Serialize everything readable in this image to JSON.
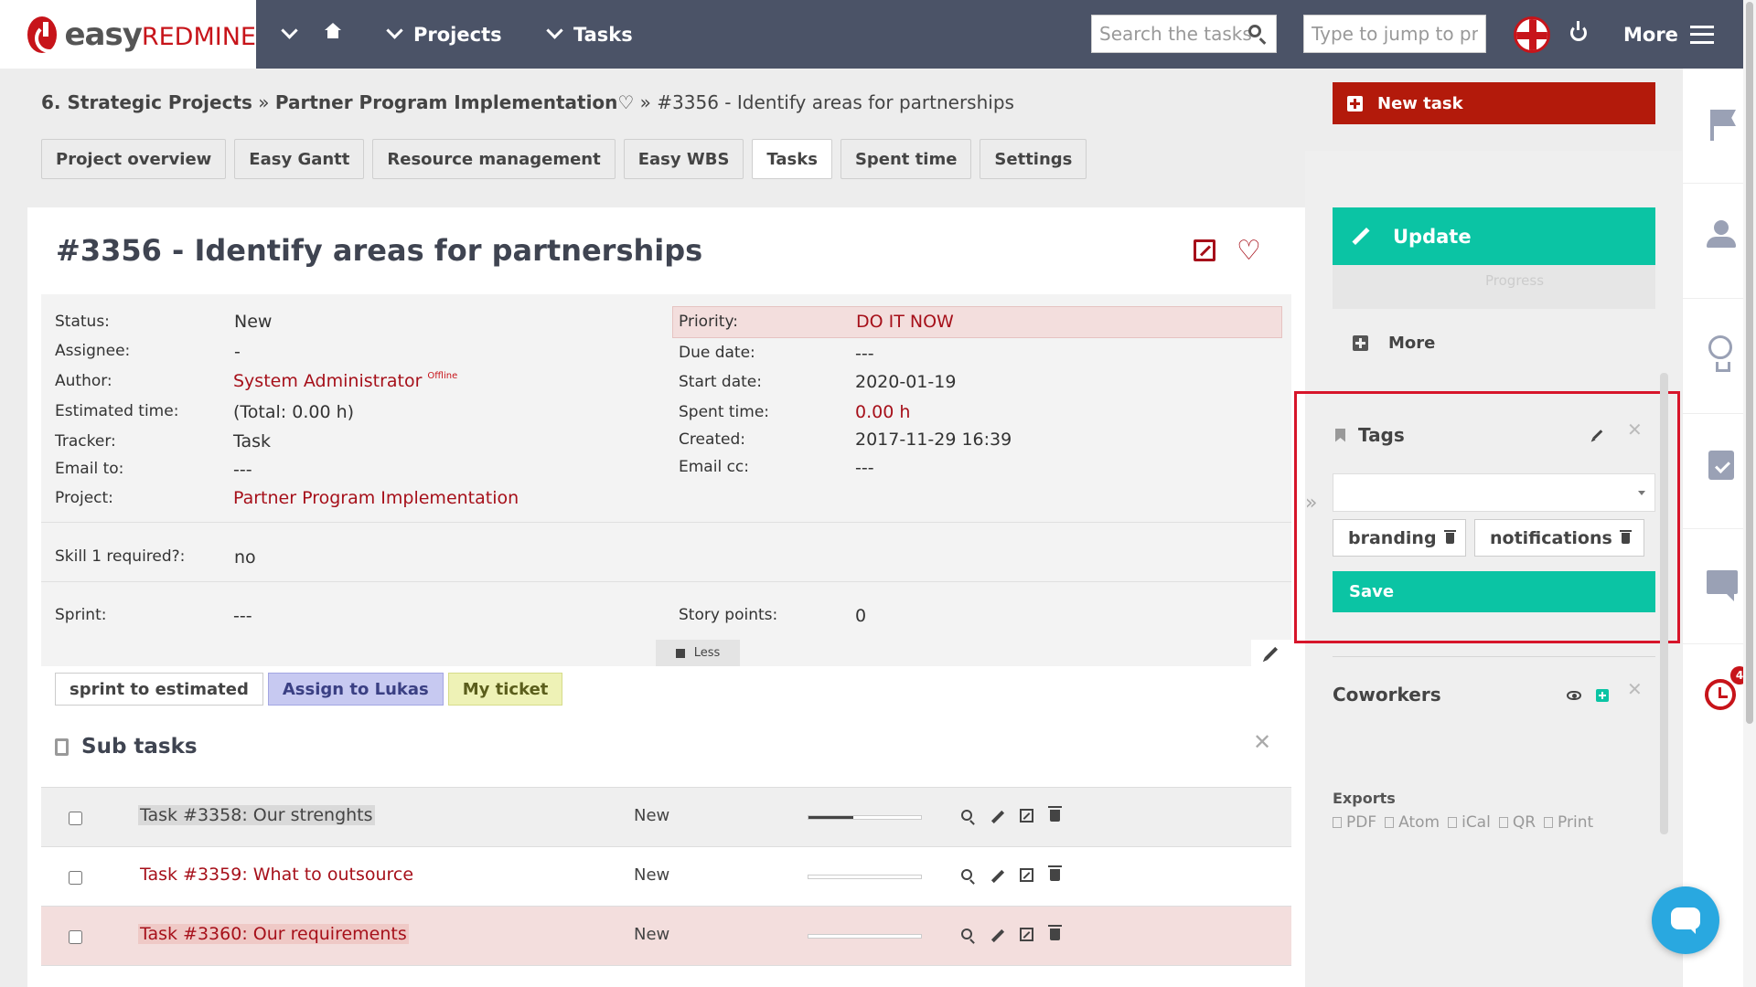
{
  "app": {
    "logo_main": "easy",
    "logo_sub": "REDMINE"
  },
  "topnav": {
    "projects_label": "Projects",
    "tasks_label": "Tasks",
    "search_placeholder": "Search the tasks",
    "jump_placeholder": "Type to jump to project",
    "more_label": "More"
  },
  "breadcrumb": {
    "parent": "6. Strategic Projects",
    "sep1": " » ",
    "project": "Partner Program Implementation♡",
    "sep2": " » ",
    "current": "#3356 - Identify areas for partnerships"
  },
  "project_tabs": [
    {
      "label": "Project overview",
      "active": false
    },
    {
      "label": "Easy Gantt",
      "active": false
    },
    {
      "label": "Resource management",
      "active": false
    },
    {
      "label": "Easy WBS",
      "active": false
    },
    {
      "label": "Tasks",
      "active": true
    },
    {
      "label": "Spent time",
      "active": false
    },
    {
      "label": "Settings",
      "active": false
    }
  ],
  "issue": {
    "title": "#3356 - Identify areas for partnerships",
    "favorite_icon": "♡",
    "left_attrs": {
      "status_label": "Status:",
      "status": "New",
      "assignee_label": "Assignee:",
      "assignee": "-",
      "author_label": "Author:",
      "author": "System Administrator",
      "author_state": "Offline",
      "estimated_label": "Estimated time:",
      "estimated": "(Total: 0.00 h)",
      "tracker_label": "Tracker:",
      "tracker": "Task",
      "email_to_label": "Email to:",
      "email_to": "---",
      "project_label": "Project:",
      "project": "Partner Program Implementation",
      "skill_label": "Skill 1 required?:",
      "skill": "no",
      "sprint_label": "Sprint:",
      "sprint": "---"
    },
    "right_attrs": {
      "priority_label": "Priority:",
      "priority": "DO IT NOW",
      "due_label": "Due date:",
      "due": "---",
      "start_label": "Start date:",
      "start": "2020-01-19",
      "spent_label": "Spent time:",
      "spent": "0.00 h",
      "created_label": "Created:",
      "created": "2017-11-29 16:39",
      "email_cc_label": "Email cc:",
      "email_cc": "---",
      "story_label": "Story points:",
      "story": "0"
    },
    "less_label": "Less",
    "action_chips": [
      "sprint to estimated",
      "Assign to Lukas",
      "My ticket"
    ]
  },
  "subtasks": {
    "heading": "Sub tasks",
    "rows": [
      {
        "title": "Task #3358: Our strenghts",
        "status": "New",
        "progress": 0.4
      },
      {
        "title": "Task #3359: What to outsource",
        "status": "New",
        "progress": 0
      },
      {
        "title": "Task #3360: Our requirements",
        "status": "New",
        "progress": 0
      }
    ]
  },
  "sidebar": {
    "new_task": "New task",
    "update": "Update",
    "progress_ghost": "Progress",
    "more": "More",
    "tags": {
      "title": "Tags",
      "items": [
        "branding",
        "notifications"
      ],
      "save": "Save"
    },
    "coworkers": "Coworkers",
    "exports_title": "Exports",
    "exports": [
      "PDF",
      "Atom",
      "iCal",
      "QR",
      "Print"
    ]
  },
  "rail": {
    "alarm_badge": "4"
  },
  "colors": {
    "topbar": "#4b5367",
    "brand_red": "#c7141a",
    "new_task": "#b31a0b",
    "accent_green": "#0bc4a4",
    "highlight_box": "#d7152a"
  }
}
